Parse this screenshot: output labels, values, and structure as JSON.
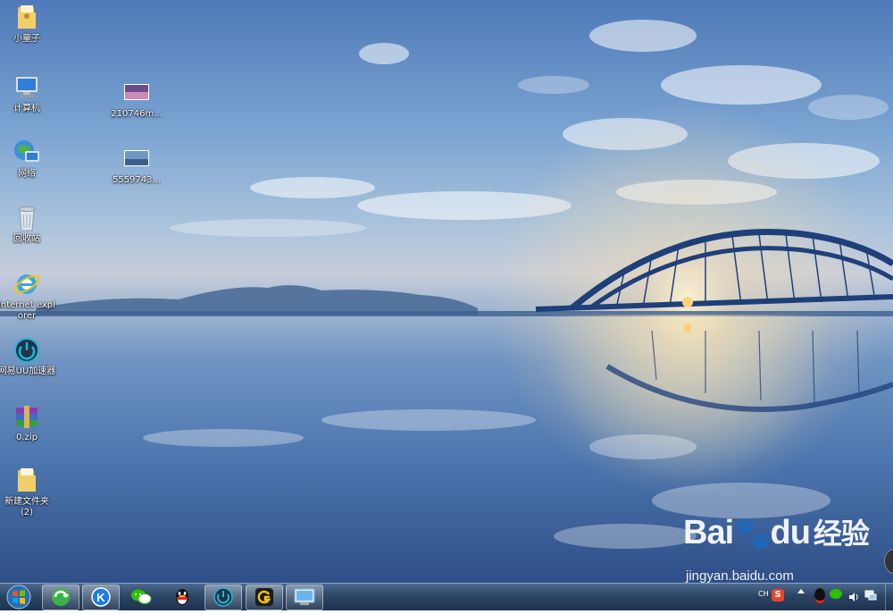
{
  "desktop": {
    "icons": [
      {
        "label": "小童子",
        "icon": "folder-icon"
      },
      {
        "label": "计算机",
        "icon": "computer-icon"
      },
      {
        "label": "网络",
        "icon": "network-icon"
      },
      {
        "label": "回收站",
        "icon": "recycle-bin-icon"
      },
      {
        "label": "internet explorer",
        "icon": "ie-icon"
      },
      {
        "label": "网易UU加速器",
        "icon": "uu-accelerator-icon"
      },
      {
        "label": "0.zip",
        "icon": "winrar-archive-icon"
      },
      {
        "label": "新建文件夹 (2)",
        "icon": "folder-icon"
      },
      {
        "label": "210746m...",
        "icon": "image-thumbnail-icon"
      },
      {
        "label": "5559743...",
        "icon": "image-thumbnail-icon"
      }
    ]
  },
  "taskbar": {
    "pinned": [
      {
        "name": "360-browser-icon",
        "color": "#3cb34a"
      },
      {
        "name": "kugou-icon",
        "color": "#1f7ce0"
      },
      {
        "name": "wechat-icon",
        "color": "#2dc100"
      },
      {
        "name": "qq-icon",
        "color": "#111111"
      },
      {
        "name": "uu-accelerator-icon",
        "color": "#1fb6d6"
      },
      {
        "name": "g-app-icon",
        "color": "#f2c200"
      },
      {
        "name": "remote-desktop-icon",
        "color": "#6fb3e8"
      }
    ],
    "tray": {
      "language": "CH",
      "icons": [
        "sogou-input-icon",
        "show-hidden-icons-arrow",
        "qq-tray-icon",
        "wechat-tray-icon",
        "volume-icon",
        "network-tray-icon"
      ]
    }
  },
  "watermark": {
    "brand": "Bai",
    "brand_paw": "du",
    "brand_cn": "经验",
    "url": "jingyan.baidu.com"
  },
  "colors": {
    "sky_top": "#4f79b8",
    "horizon": "#c6cddb",
    "water_deep": "#2e4e86",
    "bridge": "#1e3f7a",
    "sun": "#ffd27a"
  }
}
